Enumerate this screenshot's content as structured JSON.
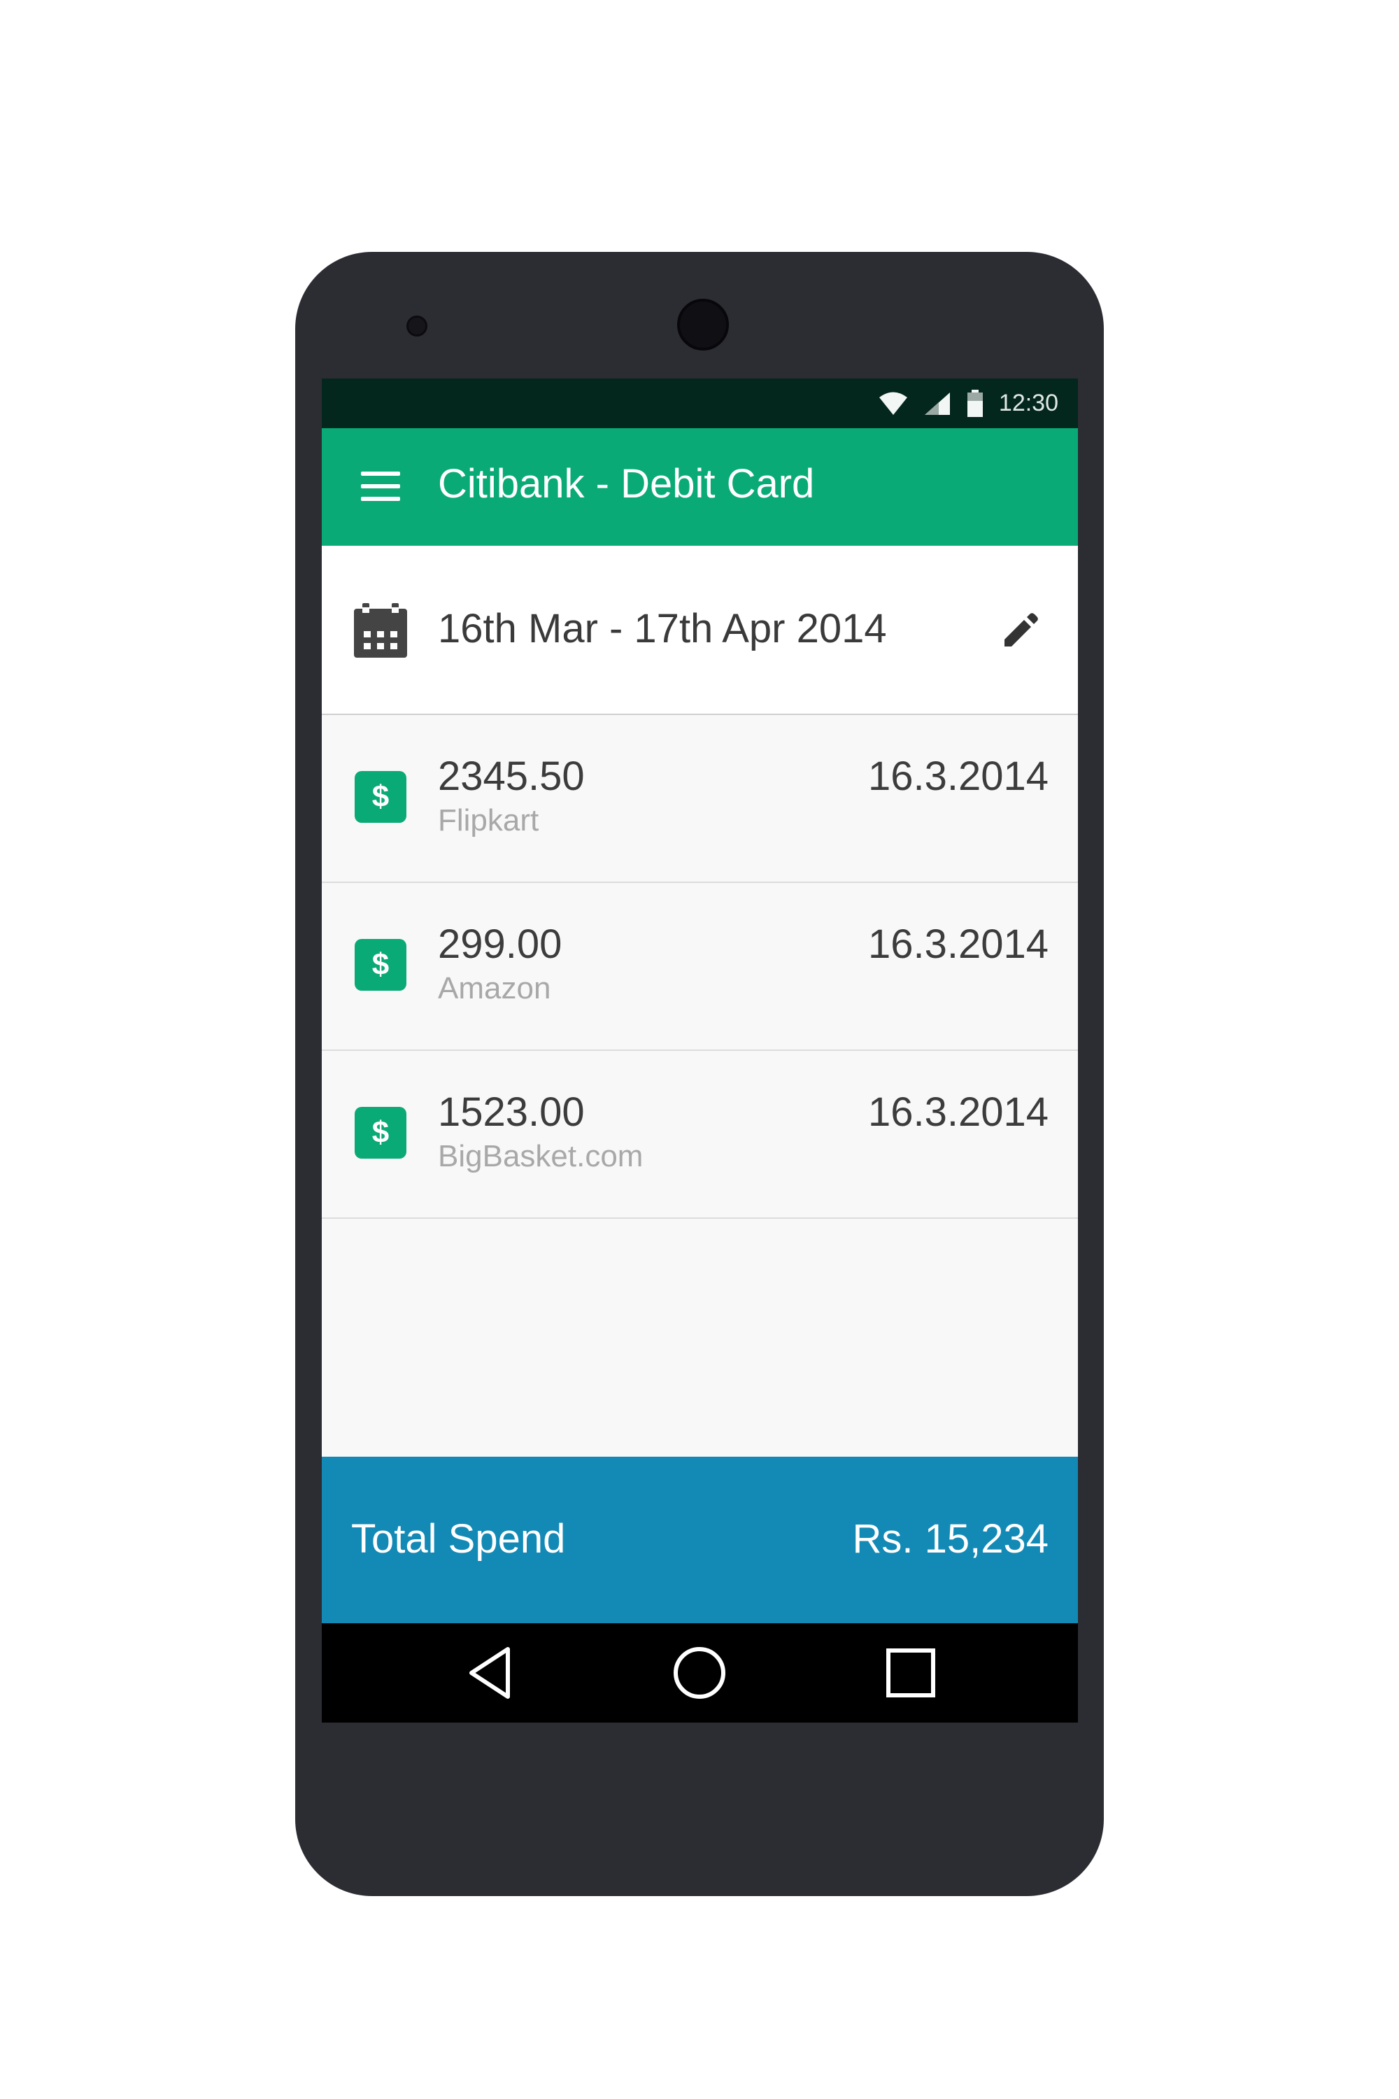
{
  "status_bar": {
    "time": "12:30",
    "icons": [
      "wifi-icon",
      "signal-icon",
      "battery-icon"
    ]
  },
  "app_bar": {
    "title": "Citibank - Debit Card",
    "menu_icon": "menu-icon"
  },
  "date_range": {
    "text": "16th Mar - 17th Apr 2014",
    "calendar_icon": "calendar-icon",
    "edit_icon": "edit-icon"
  },
  "transactions": [
    {
      "amount": "2345.50",
      "merchant": "Flipkart",
      "date": "16.3.2014",
      "icon": "$"
    },
    {
      "amount": "299.00",
      "merchant": "Amazon",
      "date": "16.3.2014",
      "icon": "$"
    },
    {
      "amount": "1523.00",
      "merchant": "BigBasket.com",
      "date": "16.3.2014",
      "icon": "$"
    }
  ],
  "total": {
    "label": "Total Spend",
    "value": "Rs. 15,234"
  },
  "navigation": {
    "buttons": [
      "back-icon",
      "home-icon",
      "recents-icon"
    ]
  },
  "colors": {
    "app_bar": "#0aaa76",
    "status_bar": "#03261d",
    "total_bar": "#138ab6",
    "device_body": "#2c2c33",
    "nav_bar": "#000000"
  }
}
